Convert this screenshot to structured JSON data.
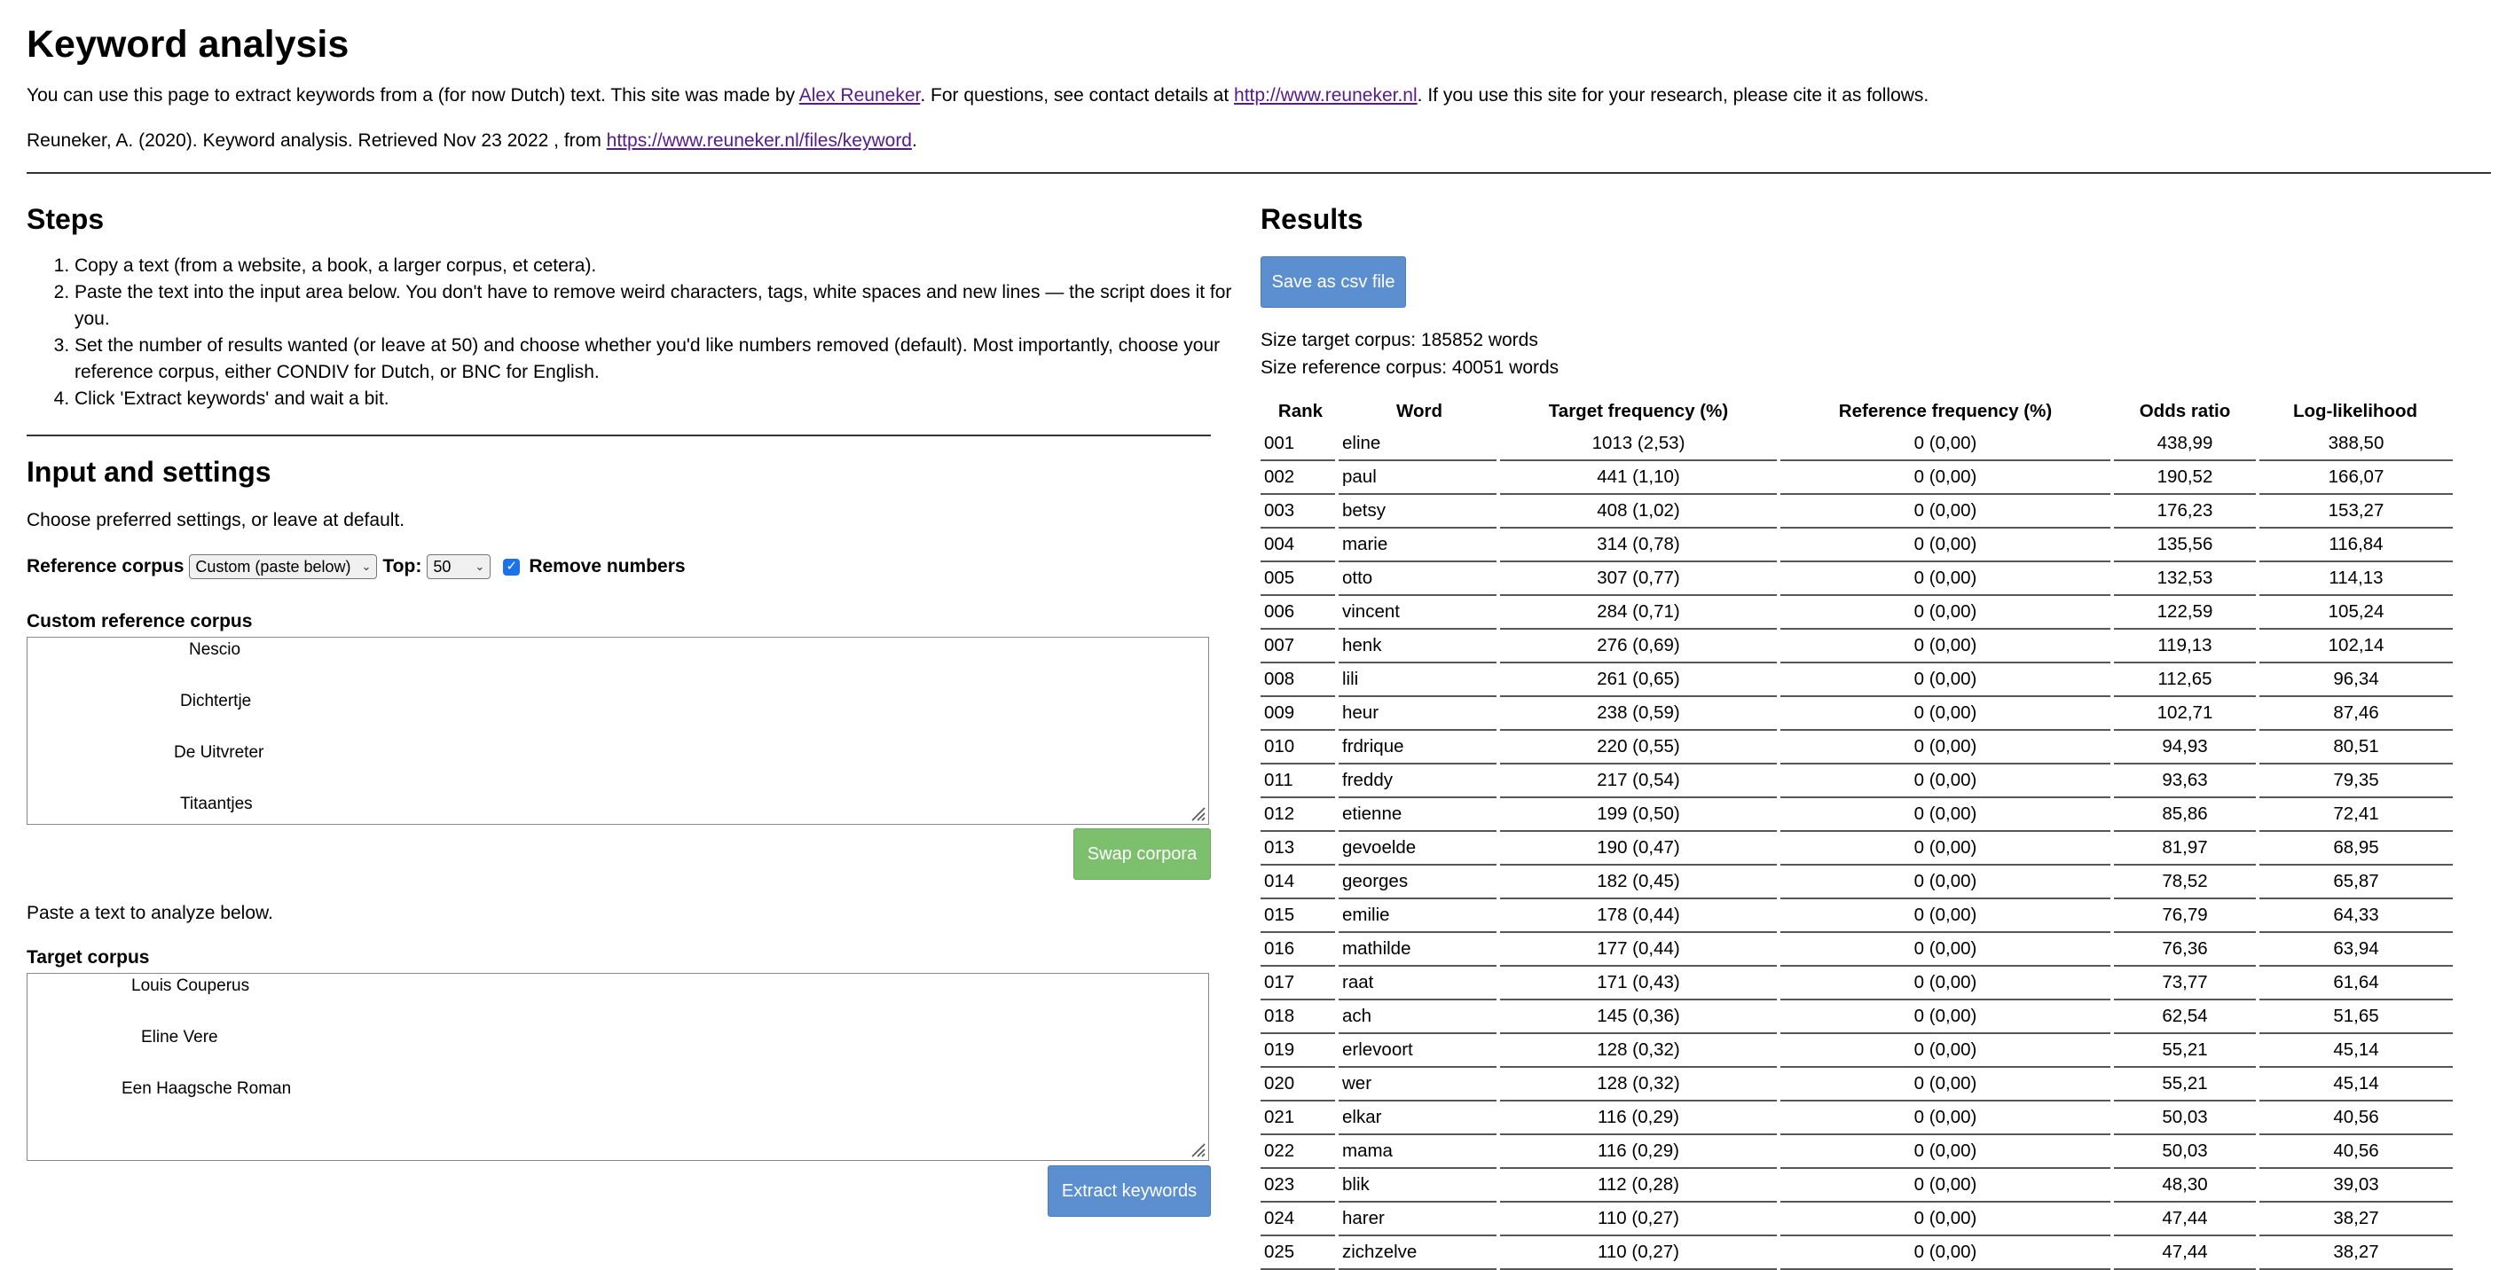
{
  "page": {
    "title": "Keyword analysis",
    "intro_before_link": "You can use this page to extract keywords from a (for now Dutch) text. This site was made by ",
    "intro_author_link": "Alex Reuneker",
    "intro_mid": ". For questions, see contact details at ",
    "intro_site_link": "http://www.reuneker.nl",
    "intro_after": ". If you use this site for your research, please cite it as follows.",
    "cite_text": "Reuneker, A. (2020). Keyword analysis. Retrieved Nov 23 2022 , from ",
    "cite_link": "https://www.reuneker.nl/files/keyword",
    "cite_end": "."
  },
  "steps": {
    "heading": "Steps",
    "items": [
      "Copy a text (from a website, a book, a larger corpus, et cetera).",
      "Paste the text into the input area below. You don't have to remove weird characters, tags, white spaces and new lines — the script does it for you.",
      "Set the number of results wanted (or leave at 50) and choose whether you'd like numbers removed (default). Most importantly, choose your reference corpus, either CONDIV for Dutch, or BNC for English.",
      "Click 'Extract keywords' and wait a bit."
    ]
  },
  "input": {
    "heading": "Input and settings",
    "hint": "Choose preferred settings, or leave at default.",
    "ref_label": "Reference corpus",
    "ref_value": "Custom (paste below)",
    "top_label": "Top:",
    "top_value": "50",
    "remove_numbers_label": "Remove numbers",
    "custom_label": "Custom reference corpus",
    "custom_lines": [
      "Nescio",
      "Dichtertje",
      "De Uitvreter",
      "Titaantjes"
    ],
    "swap_button": "Swap corpora",
    "paste_hint": "Paste a text to analyze below.",
    "target_label": "Target corpus",
    "target_lines": [
      "Louis Couperus",
      "Eline Vere",
      "Een Haagsche Roman"
    ],
    "extract_button": "Extract keywords"
  },
  "results": {
    "heading": "Results",
    "save_button": "Save as csv file",
    "size_target": "Size target corpus: 185852 words",
    "size_reference": "Size reference corpus: 40051 words",
    "columns": [
      "Rank",
      "Word",
      "Target frequency (%)",
      "Reference frequency (%)",
      "Odds ratio",
      "Log-likelihood"
    ],
    "rows": [
      [
        "001",
        "eline",
        "1013 (2,53)",
        "0 (0,00)",
        "438,99",
        "388,50"
      ],
      [
        "002",
        "paul",
        "441 (1,10)",
        "0 (0,00)",
        "190,52",
        "166,07"
      ],
      [
        "003",
        "betsy",
        "408 (1,02)",
        "0 (0,00)",
        "176,23",
        "153,27"
      ],
      [
        "004",
        "marie",
        "314 (0,78)",
        "0 (0,00)",
        "135,56",
        "116,84"
      ],
      [
        "005",
        "otto",
        "307 (0,77)",
        "0 (0,00)",
        "132,53",
        "114,13"
      ],
      [
        "006",
        "vincent",
        "284 (0,71)",
        "0 (0,00)",
        "122,59",
        "105,24"
      ],
      [
        "007",
        "henk",
        "276 (0,69)",
        "0 (0,00)",
        "119,13",
        "102,14"
      ],
      [
        "008",
        "lili",
        "261 (0,65)",
        "0 (0,00)",
        "112,65",
        "96,34"
      ],
      [
        "009",
        "heur",
        "238 (0,59)",
        "0 (0,00)",
        "102,71",
        "87,46"
      ],
      [
        "010",
        "frdrique",
        "220 (0,55)",
        "0 (0,00)",
        "94,93",
        "80,51"
      ],
      [
        "011",
        "freddy",
        "217 (0,54)",
        "0 (0,00)",
        "93,63",
        "79,35"
      ],
      [
        "012",
        "etienne",
        "199 (0,50)",
        "0 (0,00)",
        "85,86",
        "72,41"
      ],
      [
        "013",
        "gevoelde",
        "190 (0,47)",
        "0 (0,00)",
        "81,97",
        "68,95"
      ],
      [
        "014",
        "georges",
        "182 (0,45)",
        "0 (0,00)",
        "78,52",
        "65,87"
      ],
      [
        "015",
        "emilie",
        "178 (0,44)",
        "0 (0,00)",
        "76,79",
        "64,33"
      ],
      [
        "016",
        "mathilde",
        "177 (0,44)",
        "0 (0,00)",
        "76,36",
        "63,94"
      ],
      [
        "017",
        "raat",
        "171 (0,43)",
        "0 (0,00)",
        "73,77",
        "61,64"
      ],
      [
        "018",
        "ach",
        "145 (0,36)",
        "0 (0,00)",
        "62,54",
        "51,65"
      ],
      [
        "019",
        "erlevoort",
        "128 (0,32)",
        "0 (0,00)",
        "55,21",
        "45,14"
      ],
      [
        "020",
        "wer",
        "128 (0,32)",
        "0 (0,00)",
        "55,21",
        "45,14"
      ],
      [
        "021",
        "elkar",
        "116 (0,29)",
        "0 (0,00)",
        "50,03",
        "40,56"
      ],
      [
        "022",
        "mama",
        "116 (0,29)",
        "0 (0,00)",
        "50,03",
        "40,56"
      ],
      [
        "023",
        "blik",
        "112 (0,28)",
        "0 (0,00)",
        "48,30",
        "39,03"
      ],
      [
        "024",
        "harer",
        "110 (0,27)",
        "0 (0,00)",
        "47,44",
        "38,27"
      ],
      [
        "025",
        "zichzelve",
        "110 (0,27)",
        "0 (0,00)",
        "47,44",
        "38,27"
      ]
    ]
  }
}
